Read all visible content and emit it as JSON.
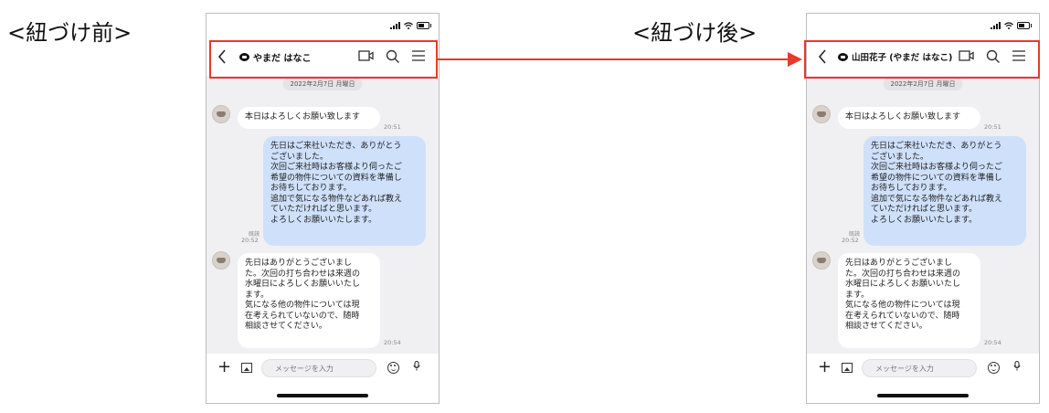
{
  "labels": {
    "before": "<紐づけ前>",
    "after": "<紐づけ後>"
  },
  "colors": {
    "highlight": "#e8392a",
    "my_bubble": "#cfe0fb",
    "chat_bg": "#f0f0f2"
  },
  "before": {
    "contact_name": "やまだ はなこ",
    "date_chip": "2022年2月7日 月曜日",
    "input_placeholder": "メッセージを入力",
    "messages": [
      {
        "lines": [
          "本日はよろしくお願い致します"
        ],
        "time": "20:51"
      },
      {
        "lines": [
          "先日はご来社いただき、ありがとう",
          "ございました。",
          "次回ご来社時はお客様より伺ったご",
          "希望の物件についての資料を準備し",
          "お待ちしております。",
          "追加で気になる物件などあれば教え",
          "ていただければと思います。",
          "よろしくお願いいたします。"
        ],
        "read": "既読",
        "time": "20:52"
      },
      {
        "lines": [
          "先日はありがとうございまし",
          "た。次回の打ち合わせは来週の",
          "水曜日によろしくお願いいたし",
          "ます。",
          "気になる他の物件については現",
          "在考えられていないので、随時",
          "相談させてください。"
        ],
        "time": "20:54"
      }
    ]
  },
  "after": {
    "contact_name": "山田花子 (やまだ はなこ)",
    "date_chip": "2022年2月7日 月曜日",
    "input_placeholder": "メッセージを入力",
    "messages": [
      {
        "lines": [
          "本日はよろしくお願い致します"
        ],
        "time": "20:51"
      },
      {
        "lines": [
          "先日はご来社いただき、ありがとう",
          "ございました。",
          "次回ご来社時はお客様より伺ったご",
          "希望の物件についての資料を準備し",
          "お待ちしております。",
          "追加で気になる物件などあれば教え",
          "ていただければと思います。",
          "よろしくお願いいたします。"
        ],
        "read": "既読",
        "time": "20:52"
      },
      {
        "lines": [
          "先日はありがとうございまし",
          "た。次回の打ち合わせは来週の",
          "水曜日によろしくお願いいたし",
          "ます。",
          "気になる他の物件については現",
          "在考えられていないので、随時",
          "相談させてください。"
        ],
        "time": "20:54"
      }
    ]
  }
}
